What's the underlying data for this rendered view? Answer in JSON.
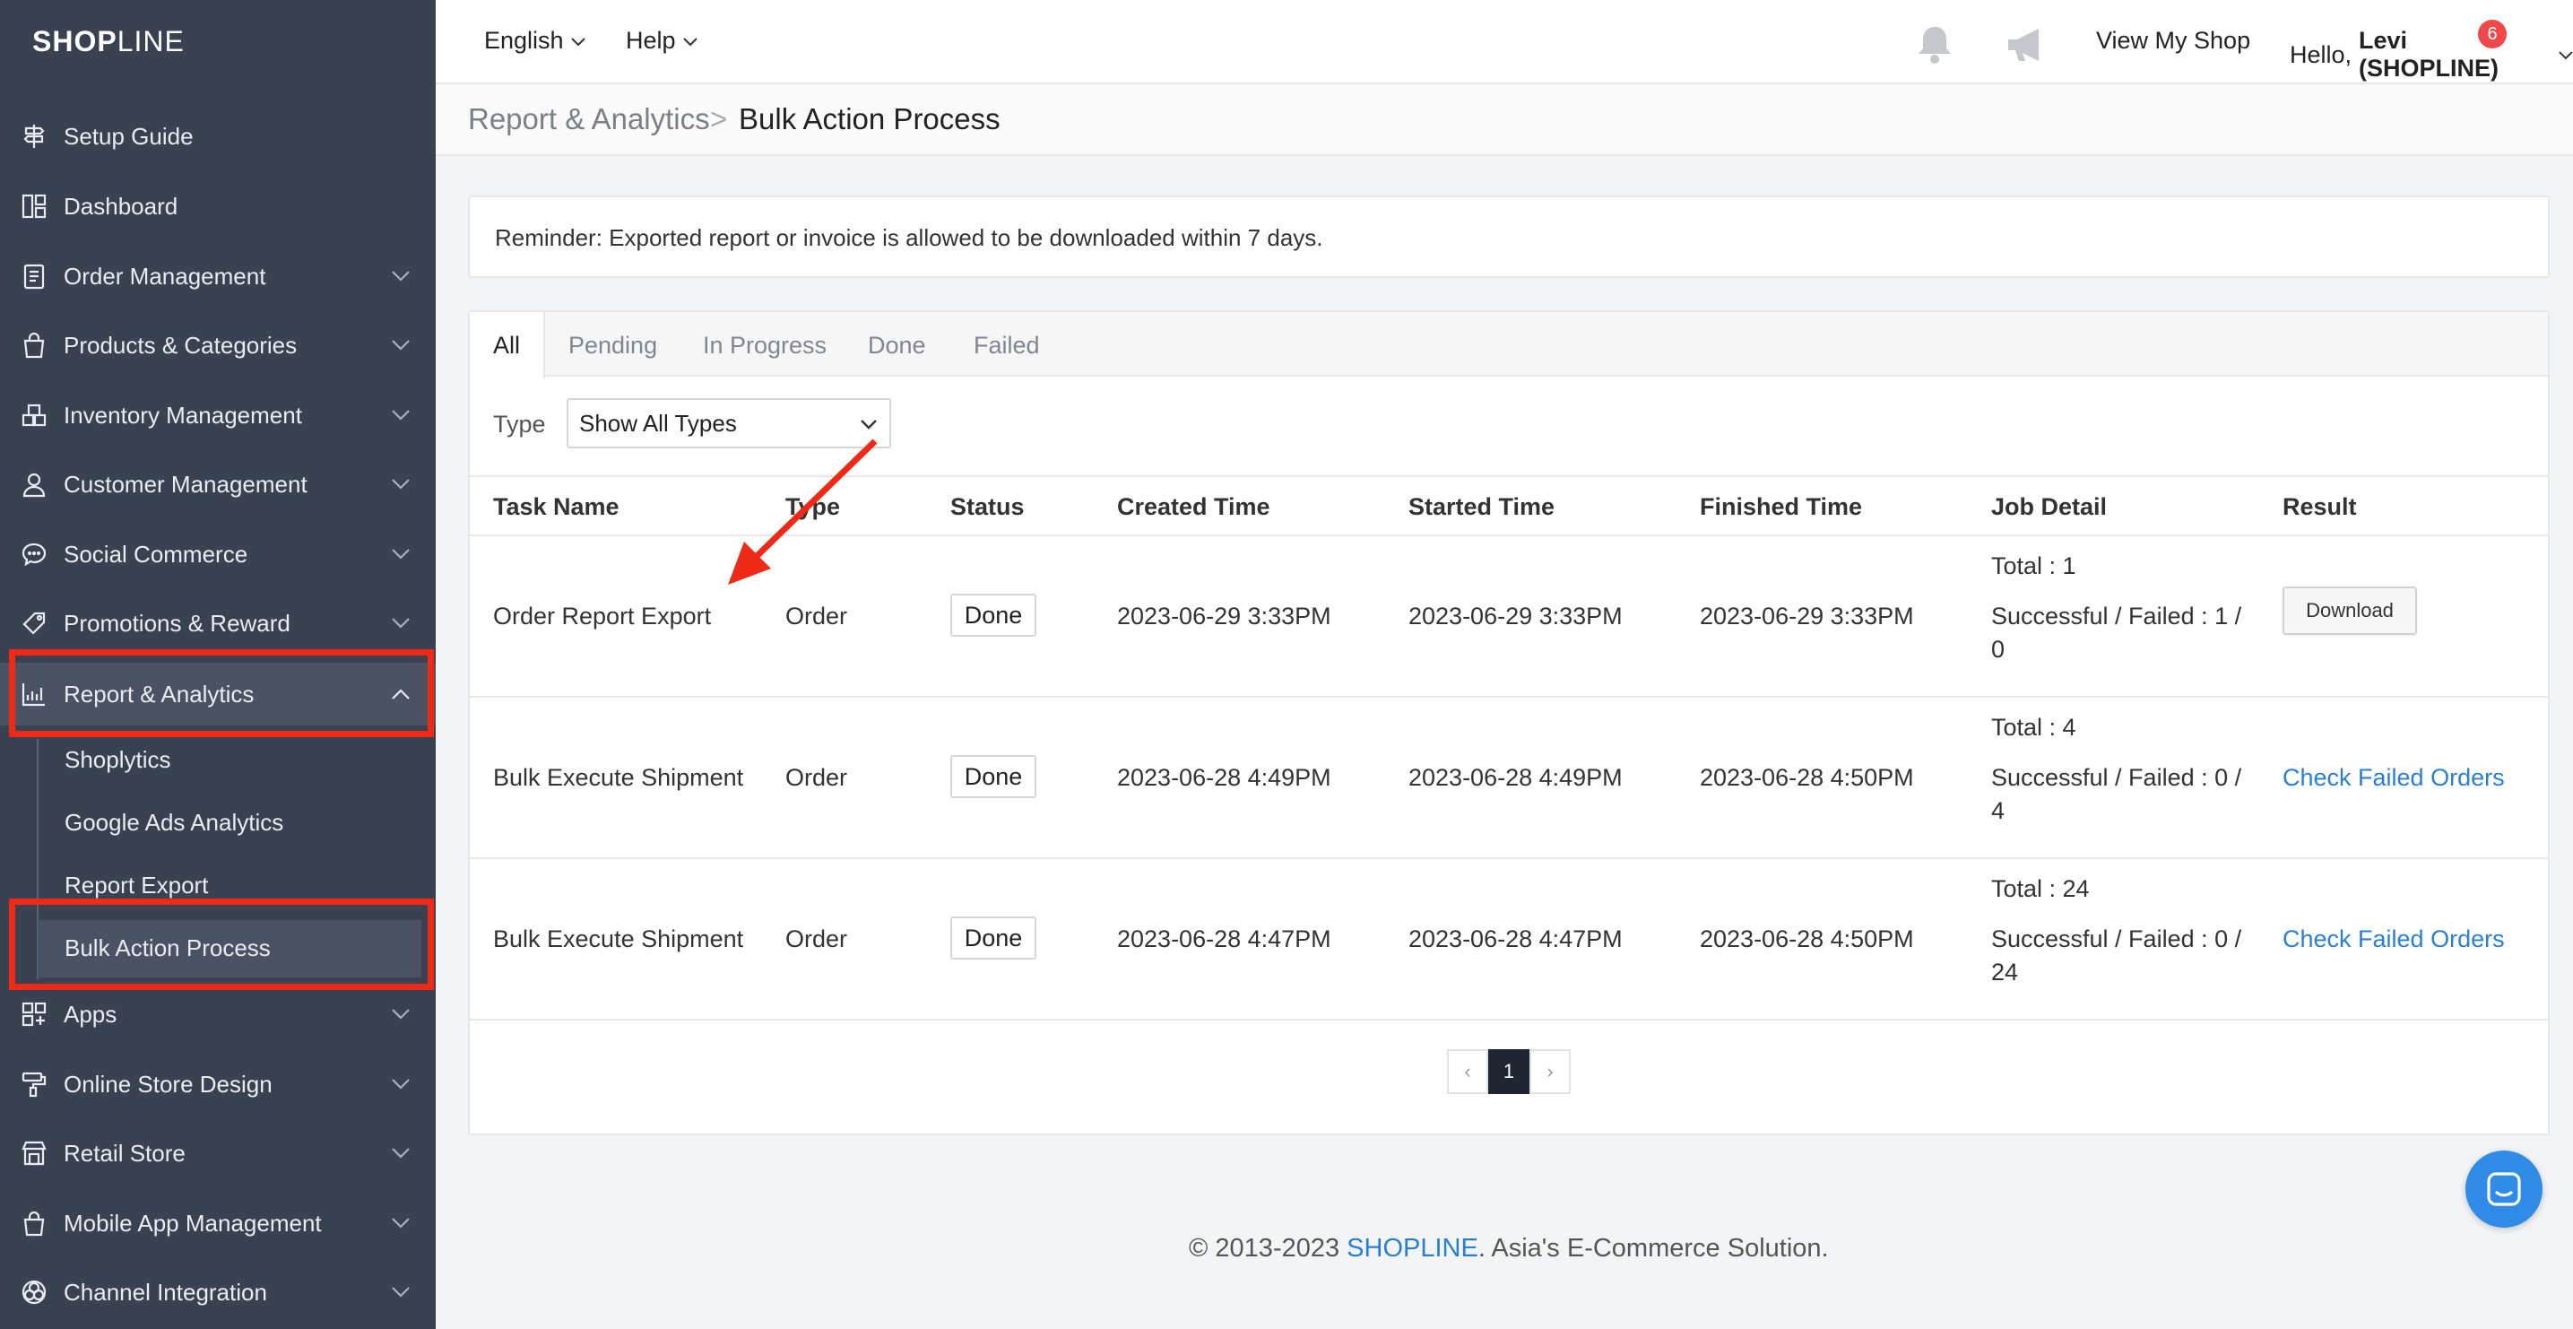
{
  "brand": {
    "logo_bold": "SHOP",
    "logo_thin": "LINE"
  },
  "sidebar": {
    "items": [
      {
        "label": "Setup Guide",
        "icon": "signpost-icon"
      },
      {
        "label": "Dashboard",
        "icon": "dashboard-icon"
      },
      {
        "label": "Order Management",
        "icon": "clipboard-icon"
      },
      {
        "label": "Products & Categories",
        "icon": "shopping-bag-icon"
      },
      {
        "label": "Inventory Management",
        "icon": "boxes-icon"
      },
      {
        "label": "Customer Management",
        "icon": "user-icon"
      },
      {
        "label": "Social Commerce",
        "icon": "chat-bubble-icon"
      },
      {
        "label": "Promotions & Reward",
        "icon": "tag-icon"
      },
      {
        "label": "Report & Analytics",
        "icon": "chart-icon"
      },
      {
        "label": "Apps",
        "icon": "apps-grid-icon"
      },
      {
        "label": "Online Store Design",
        "icon": "paint-roller-icon"
      },
      {
        "label": "Retail Store",
        "icon": "store-icon"
      },
      {
        "label": "Mobile App Management",
        "icon": "mobile-bag-icon"
      },
      {
        "label": "Channel Integration",
        "icon": "integration-icon"
      }
    ],
    "sub_items": [
      "Shoplytics",
      "Google Ads Analytics",
      "Report Export",
      "Bulk Action Process"
    ]
  },
  "topbar": {
    "language": "English",
    "help": "Help",
    "notification_count": "6",
    "view_shop": "View My Shop",
    "greeting": "Hello,",
    "user": "Levi (SHOPLINE)"
  },
  "breadcrumb": {
    "parent": "Report & Analytics",
    "separator": ">",
    "current": "Bulk Action Process"
  },
  "reminder": "Reminder: Exported report or invoice is allowed to be downloaded within 7 days.",
  "tabs": [
    "All",
    "Pending",
    "In Progress",
    "Done",
    "Failed"
  ],
  "filter": {
    "label": "Type",
    "value": "Show All Types"
  },
  "table": {
    "headers": [
      "Task Name",
      "Type",
      "Status",
      "Created Time",
      "Started Time",
      "Finished Time",
      "Job Detail",
      "Result"
    ],
    "rows": [
      {
        "task": "Order Report Export",
        "type": "Order",
        "status": "Done",
        "created": "2023-06-29 3:33PM",
        "started": "2023-06-29 3:33PM",
        "finished": "2023-06-29 3:33PM",
        "total": "Total : 1",
        "detail_1": "Successful / Failed : 1 /",
        "detail_2": "0",
        "result": "Download"
      },
      {
        "task": "Bulk Execute Shipment",
        "type": "Order",
        "status": "Done",
        "created": "2023-06-28 4:49PM",
        "started": "2023-06-28 4:49PM",
        "finished": "2023-06-28 4:50PM",
        "total": "Total : 4",
        "detail_1": "Successful / Failed : 0 /",
        "detail_2": "4",
        "result": "Check Failed Orders"
      },
      {
        "task": "Bulk Execute Shipment",
        "type": "Order",
        "status": "Done",
        "created": "2023-06-28 4:47PM",
        "started": "2023-06-28 4:47PM",
        "finished": "2023-06-28 4:50PM",
        "total": "Total : 24",
        "detail_1": "Successful / Failed : 0 /",
        "detail_2": "24",
        "result": "Check Failed Orders"
      }
    ]
  },
  "pagination": {
    "prev": "‹",
    "current": "1",
    "next": "›"
  },
  "footer": {
    "prefix": "© 2013-2023 ",
    "brand": "SHOPLINE",
    "suffix": ". Asia's E-Commerce Solution."
  },
  "colors": {
    "sidebar_bg": "#3a4252",
    "highlight": "#ee2a17",
    "link": "#2a7fd4",
    "badge": "#f04949"
  }
}
